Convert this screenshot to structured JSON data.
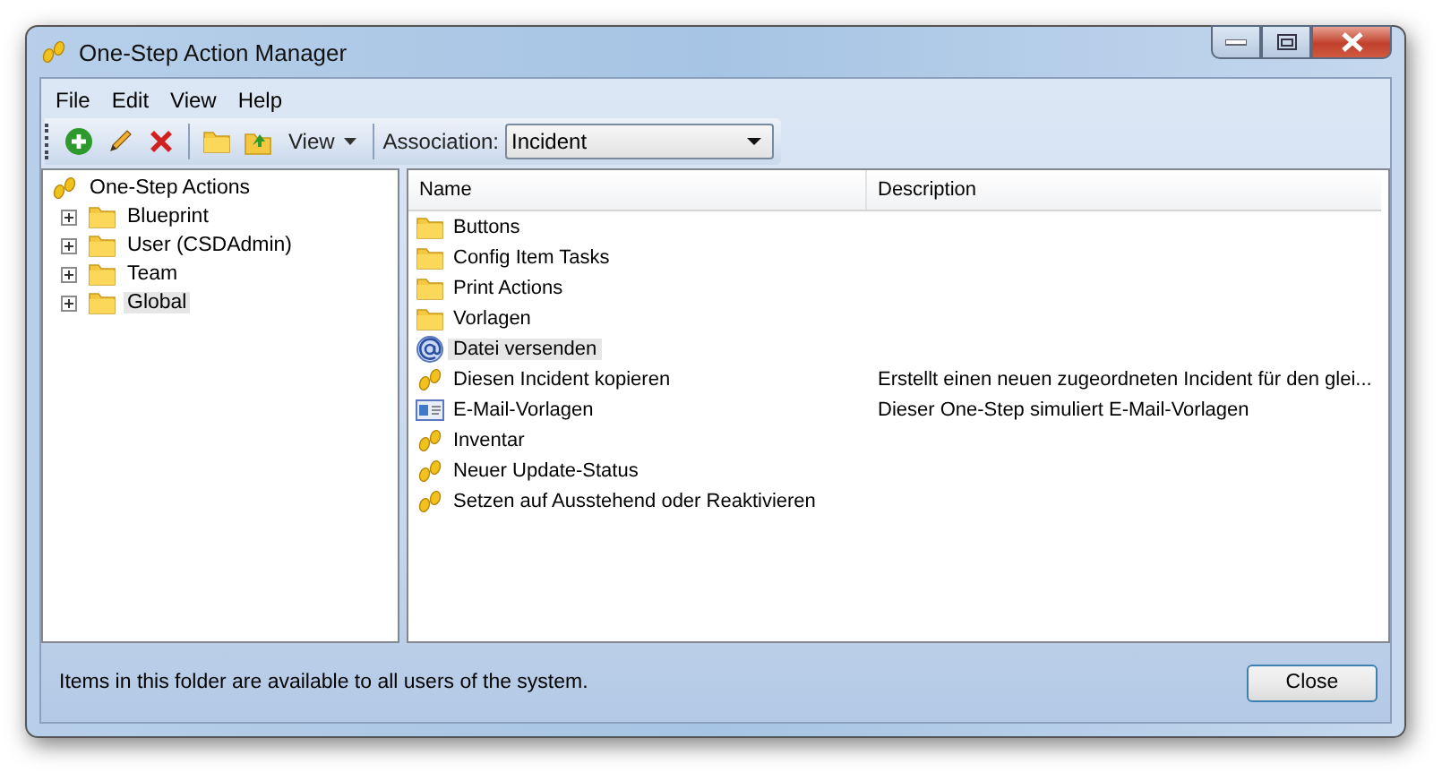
{
  "window": {
    "title": "One-Step Action Manager"
  },
  "menu": [
    "File",
    "Edit",
    "View",
    "Help"
  ],
  "toolbar": {
    "view_label": "View",
    "association_label": "Association:",
    "association_value": "Incident"
  },
  "tree": {
    "root": "One-Step Actions",
    "children": [
      {
        "label": "Blueprint",
        "expanded": false,
        "selected": false
      },
      {
        "label": "User (CSDAdmin)",
        "expanded": false,
        "selected": false
      },
      {
        "label": "Team",
        "expanded": false,
        "selected": false
      },
      {
        "label": "Global",
        "expanded": false,
        "selected": true
      }
    ]
  },
  "list": {
    "columns": [
      "Name",
      "Description"
    ],
    "rows": [
      {
        "kind": "folder",
        "name": "Buttons",
        "selected": false
      },
      {
        "kind": "folder",
        "name": "Config Item Tasks",
        "selected": false
      },
      {
        "kind": "folder",
        "name": "Print Actions",
        "selected": false
      },
      {
        "kind": "folder",
        "name": "Vorlagen",
        "selected": false
      },
      {
        "kind": "mail",
        "name": "Datei versenden",
        "selected": true
      },
      {
        "kind": "action",
        "name": "Diesen Incident kopieren",
        "description": "Erstellt einen neuen zugeordneten Incident für den glei...",
        "selected": false
      },
      {
        "kind": "template",
        "name": "E-Mail-Vorlagen",
        "description": "Dieser One-Step simuliert E-Mail-Vorlagen",
        "selected": false
      },
      {
        "kind": "action",
        "name": "Inventar",
        "selected": false
      },
      {
        "kind": "action",
        "name": "Neuer Update-Status",
        "selected": false
      },
      {
        "kind": "action",
        "name": "Setzen auf Ausstehend oder Reaktivieren",
        "selected": false
      }
    ]
  },
  "status_bar": "Items in this folder are available to all users of the system.",
  "buttons": [
    "Close"
  ]
}
